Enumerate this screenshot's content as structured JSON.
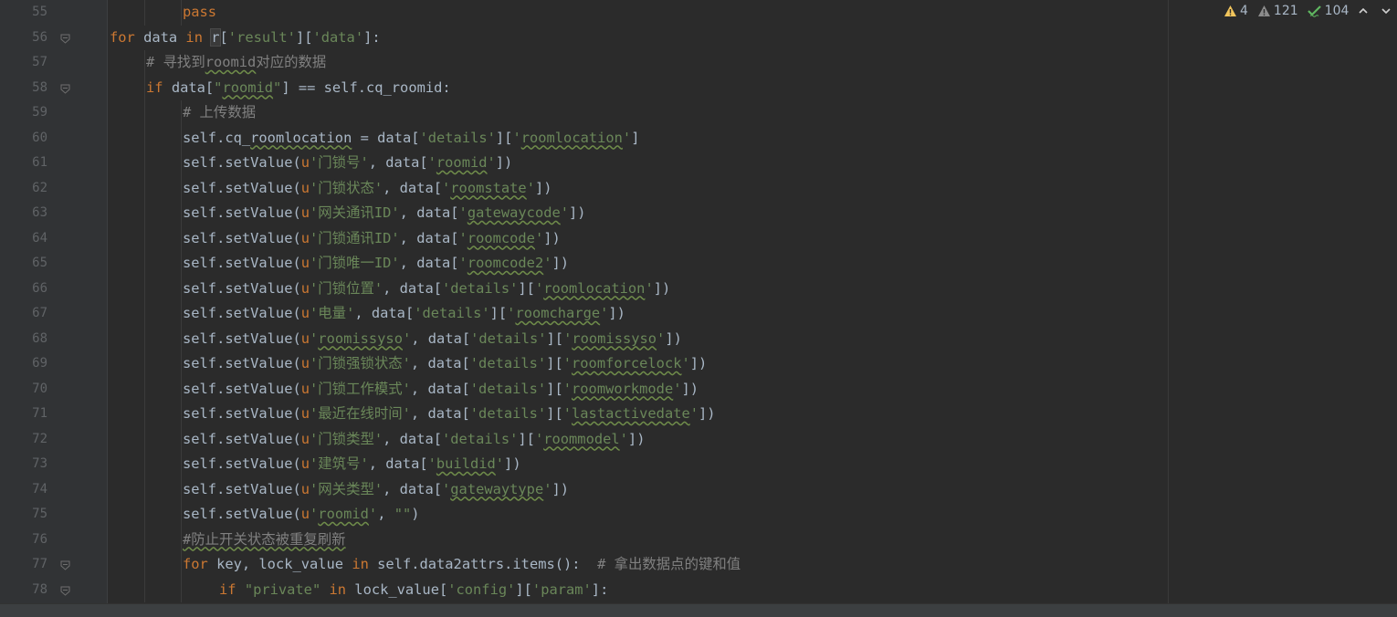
{
  "inspection": {
    "warnings": "4",
    "weak_warnings": "121",
    "typos": "104"
  },
  "lines": [
    {
      "n": "55",
      "fold": false,
      "indent": 2,
      "tokens": [
        {
          "t": "pass",
          "c": "kw"
        }
      ]
    },
    {
      "n": "56",
      "fold": true,
      "indent": 0,
      "tokens": [
        {
          "t": "for ",
          "c": "kw"
        },
        {
          "t": "data "
        },
        {
          "t": "in ",
          "c": "kw"
        },
        {
          "t": "r",
          "c": "cursor"
        },
        {
          "t": "["
        },
        {
          "t": "'result'",
          "c": "str"
        },
        {
          "t": "]["
        },
        {
          "t": "'data'",
          "c": "str"
        },
        {
          "t": "]:"
        }
      ]
    },
    {
      "n": "57",
      "fold": false,
      "indent": 1,
      "tokens": [
        {
          "t": "# 寻找到",
          "c": "cm"
        },
        {
          "t": "roomid",
          "c": "cmw"
        },
        {
          "t": "对应的数据",
          "c": "cm"
        }
      ]
    },
    {
      "n": "58",
      "fold": true,
      "indent": 1,
      "tokens": [
        {
          "t": "if ",
          "c": "kw"
        },
        {
          "t": "data["
        },
        {
          "t": "\"",
          "c": "str"
        },
        {
          "t": "roomid",
          "c": "strw"
        },
        {
          "t": "\"",
          "c": "str"
        },
        {
          "t": "] == self.cq_roomid:"
        }
      ]
    },
    {
      "n": "59",
      "fold": false,
      "indent": 2,
      "tokens": [
        {
          "t": "# 上传数据",
          "c": "cm"
        }
      ]
    },
    {
      "n": "60",
      "fold": false,
      "indent": 2,
      "tokens": [
        {
          "t": "self.cq_"
        },
        {
          "t": "roomlocation",
          "c": "w"
        },
        {
          "t": " = data["
        },
        {
          "t": "'details'",
          "c": "str"
        },
        {
          "t": "]["
        },
        {
          "t": "'",
          "c": "str"
        },
        {
          "t": "roomlocation",
          "c": "strw"
        },
        {
          "t": "'",
          "c": "str"
        },
        {
          "t": "]"
        }
      ]
    },
    {
      "n": "61",
      "fold": false,
      "indent": 2,
      "tokens": [
        {
          "t": "self.setValue("
        },
        {
          "t": "u",
          "c": "u"
        },
        {
          "t": "'门锁号'",
          "c": "str"
        },
        {
          "t": ", data["
        },
        {
          "t": "'",
          "c": "str"
        },
        {
          "t": "roomid",
          "c": "strw"
        },
        {
          "t": "'",
          "c": "str"
        },
        {
          "t": "])"
        }
      ]
    },
    {
      "n": "62",
      "fold": false,
      "indent": 2,
      "tokens": [
        {
          "t": "self.setValue("
        },
        {
          "t": "u",
          "c": "u"
        },
        {
          "t": "'门锁状态'",
          "c": "str"
        },
        {
          "t": ", data["
        },
        {
          "t": "'",
          "c": "str"
        },
        {
          "t": "roomstate",
          "c": "strw"
        },
        {
          "t": "'",
          "c": "str"
        },
        {
          "t": "])"
        }
      ]
    },
    {
      "n": "63",
      "fold": false,
      "indent": 2,
      "tokens": [
        {
          "t": "self.setValue("
        },
        {
          "t": "u",
          "c": "u"
        },
        {
          "t": "'网关通讯ID'",
          "c": "str"
        },
        {
          "t": ", data["
        },
        {
          "t": "'",
          "c": "str"
        },
        {
          "t": "gatewaycode",
          "c": "strw"
        },
        {
          "t": "'",
          "c": "str"
        },
        {
          "t": "])"
        }
      ]
    },
    {
      "n": "64",
      "fold": false,
      "indent": 2,
      "tokens": [
        {
          "t": "self.setValue("
        },
        {
          "t": "u",
          "c": "u"
        },
        {
          "t": "'门锁通讯ID'",
          "c": "str"
        },
        {
          "t": ", data["
        },
        {
          "t": "'",
          "c": "str"
        },
        {
          "t": "roomcode",
          "c": "strw"
        },
        {
          "t": "'",
          "c": "str"
        },
        {
          "t": "])"
        }
      ]
    },
    {
      "n": "65",
      "fold": false,
      "indent": 2,
      "tokens": [
        {
          "t": "self.setValue("
        },
        {
          "t": "u",
          "c": "u"
        },
        {
          "t": "'门锁唯一ID'",
          "c": "str"
        },
        {
          "t": ", data["
        },
        {
          "t": "'",
          "c": "str"
        },
        {
          "t": "roomcode2",
          "c": "strw"
        },
        {
          "t": "'",
          "c": "str"
        },
        {
          "t": "])"
        }
      ]
    },
    {
      "n": "66",
      "fold": false,
      "indent": 2,
      "tokens": [
        {
          "t": "self.setValue("
        },
        {
          "t": "u",
          "c": "u"
        },
        {
          "t": "'门锁位置'",
          "c": "str"
        },
        {
          "t": ", data["
        },
        {
          "t": "'details'",
          "c": "str"
        },
        {
          "t": "]["
        },
        {
          "t": "'",
          "c": "str"
        },
        {
          "t": "roomlocation",
          "c": "strw"
        },
        {
          "t": "'",
          "c": "str"
        },
        {
          "t": "])"
        }
      ]
    },
    {
      "n": "67",
      "fold": false,
      "indent": 2,
      "tokens": [
        {
          "t": "self.setValue("
        },
        {
          "t": "u",
          "c": "u"
        },
        {
          "t": "'电量'",
          "c": "str"
        },
        {
          "t": ", data["
        },
        {
          "t": "'details'",
          "c": "str"
        },
        {
          "t": "]["
        },
        {
          "t": "'",
          "c": "str"
        },
        {
          "t": "roomcharge",
          "c": "strw"
        },
        {
          "t": "'",
          "c": "str"
        },
        {
          "t": "])"
        }
      ]
    },
    {
      "n": "68",
      "fold": false,
      "indent": 2,
      "tokens": [
        {
          "t": "self.setValue("
        },
        {
          "t": "u",
          "c": "u"
        },
        {
          "t": "'",
          "c": "str"
        },
        {
          "t": "roomissyso",
          "c": "strw"
        },
        {
          "t": "'",
          "c": "str"
        },
        {
          "t": ", data["
        },
        {
          "t": "'details'",
          "c": "str"
        },
        {
          "t": "]["
        },
        {
          "t": "'",
          "c": "str"
        },
        {
          "t": "roomissyso",
          "c": "strw"
        },
        {
          "t": "'",
          "c": "str"
        },
        {
          "t": "])"
        }
      ]
    },
    {
      "n": "69",
      "fold": false,
      "indent": 2,
      "tokens": [
        {
          "t": "self.setValue("
        },
        {
          "t": "u",
          "c": "u"
        },
        {
          "t": "'门锁强锁状态'",
          "c": "str"
        },
        {
          "t": ", data["
        },
        {
          "t": "'details'",
          "c": "str"
        },
        {
          "t": "]["
        },
        {
          "t": "'",
          "c": "str"
        },
        {
          "t": "roomforcelock",
          "c": "strw"
        },
        {
          "t": "'",
          "c": "str"
        },
        {
          "t": "])"
        }
      ]
    },
    {
      "n": "70",
      "fold": false,
      "indent": 2,
      "tokens": [
        {
          "t": "self.setValue("
        },
        {
          "t": "u",
          "c": "u"
        },
        {
          "t": "'门锁工作模式'",
          "c": "str"
        },
        {
          "t": ", data["
        },
        {
          "t": "'details'",
          "c": "str"
        },
        {
          "t": "]["
        },
        {
          "t": "'",
          "c": "str"
        },
        {
          "t": "roomworkmode",
          "c": "strw"
        },
        {
          "t": "'",
          "c": "str"
        },
        {
          "t": "])"
        }
      ]
    },
    {
      "n": "71",
      "fold": false,
      "indent": 2,
      "tokens": [
        {
          "t": "self.setValue("
        },
        {
          "t": "u",
          "c": "u"
        },
        {
          "t": "'最近在线时间'",
          "c": "str"
        },
        {
          "t": ", data["
        },
        {
          "t": "'details'",
          "c": "str"
        },
        {
          "t": "]["
        },
        {
          "t": "'",
          "c": "str"
        },
        {
          "t": "lastactivedate",
          "c": "strw"
        },
        {
          "t": "'",
          "c": "str"
        },
        {
          "t": "])"
        }
      ]
    },
    {
      "n": "72",
      "fold": false,
      "indent": 2,
      "tokens": [
        {
          "t": "self.setValue("
        },
        {
          "t": "u",
          "c": "u"
        },
        {
          "t": "'门锁类型'",
          "c": "str"
        },
        {
          "t": ", data["
        },
        {
          "t": "'details'",
          "c": "str"
        },
        {
          "t": "]["
        },
        {
          "t": "'",
          "c": "str"
        },
        {
          "t": "roommodel",
          "c": "strw"
        },
        {
          "t": "'",
          "c": "str"
        },
        {
          "t": "])"
        }
      ]
    },
    {
      "n": "73",
      "fold": false,
      "indent": 2,
      "tokens": [
        {
          "t": "self.setValue("
        },
        {
          "t": "u",
          "c": "u"
        },
        {
          "t": "'建筑号'",
          "c": "str"
        },
        {
          "t": ", data["
        },
        {
          "t": "'",
          "c": "str"
        },
        {
          "t": "buildid",
          "c": "strw"
        },
        {
          "t": "'",
          "c": "str"
        },
        {
          "t": "])"
        }
      ]
    },
    {
      "n": "74",
      "fold": false,
      "indent": 2,
      "tokens": [
        {
          "t": "self.setValue("
        },
        {
          "t": "u",
          "c": "u"
        },
        {
          "t": "'网关类型'",
          "c": "str"
        },
        {
          "t": ", data["
        },
        {
          "t": "'",
          "c": "str"
        },
        {
          "t": "gatewaytype",
          "c": "strw"
        },
        {
          "t": "'",
          "c": "str"
        },
        {
          "t": "])"
        }
      ]
    },
    {
      "n": "75",
      "fold": false,
      "indent": 2,
      "tokens": [
        {
          "t": "self.setValue("
        },
        {
          "t": "u",
          "c": "u"
        },
        {
          "t": "'",
          "c": "str"
        },
        {
          "t": "roomid",
          "c": "strw"
        },
        {
          "t": "'",
          "c": "str"
        },
        {
          "t": ", "
        },
        {
          "t": "\"\"",
          "c": "str"
        },
        {
          "t": ")"
        }
      ]
    },
    {
      "n": "76",
      "fold": false,
      "indent": 2,
      "tokens": [
        {
          "t": "#防止开关状态被重复刷新",
          "c": "cmw"
        }
      ]
    },
    {
      "n": "77",
      "fold": true,
      "indent": 2,
      "tokens": [
        {
          "t": "for ",
          "c": "kw"
        },
        {
          "t": "key, lock_value "
        },
        {
          "t": "in ",
          "c": "kw"
        },
        {
          "t": "self.data2attrs.items():  "
        },
        {
          "t": "# 拿出数据点的键和值",
          "c": "cm"
        }
      ]
    },
    {
      "n": "78",
      "fold": true,
      "indent": 3,
      "tokens": [
        {
          "t": "if ",
          "c": "kw"
        },
        {
          "t": "\"private\"",
          "c": "str"
        },
        {
          "t": " in ",
          "c": "kw"
        },
        {
          "t": "lock_value["
        },
        {
          "t": "'config'",
          "c": "str"
        },
        {
          "t": "]["
        },
        {
          "t": "'param'",
          "c": "str"
        },
        {
          "t": "]:"
        }
      ]
    }
  ]
}
